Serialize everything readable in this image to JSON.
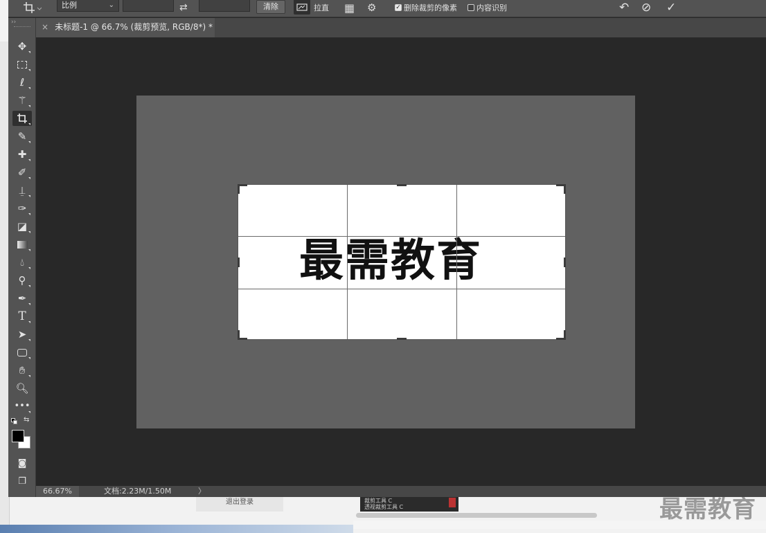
{
  "options_bar": {
    "crop_tool_icon": "crop-icon",
    "ratio_select": "比例",
    "swap_icon": "swap-icon",
    "clear_label": "清除",
    "straighten_label": "拉直",
    "delete_cropped_label": "删除裁剪的像素",
    "delete_cropped_checked": true,
    "content_aware_label": "内容识别",
    "content_aware_checked": false
  },
  "document": {
    "tab_title": "未标题-1 @ 66.7% (裁剪预览, RGB/8*) *",
    "close_glyph": "×",
    "canvas_text": "最需教育"
  },
  "status": {
    "zoom": "66.67%",
    "doc_info": "文档:2.23M/1.50M",
    "arrow": "〉"
  },
  "background": {
    "logout_label": "退出登录",
    "thumb_line1": "裁剪工具      C",
    "thumb_line2": "透视裁剪工具  C",
    "watermark": "最需教育"
  },
  "colors": {
    "foreground": "#000000",
    "background": "#ffffff",
    "ui_panel": "#535353",
    "workspace": "#282828"
  }
}
